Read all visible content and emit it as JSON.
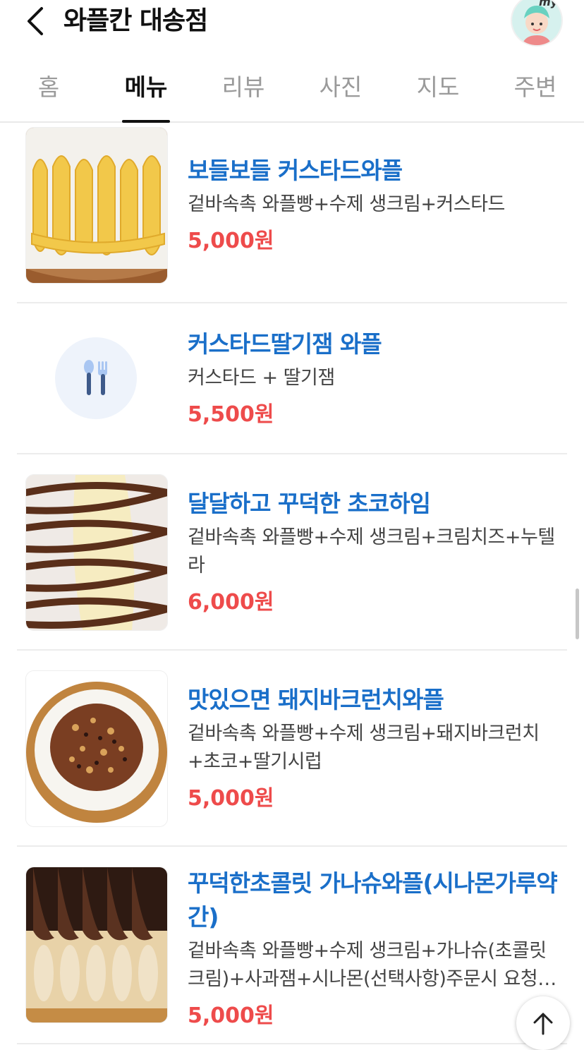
{
  "header": {
    "title": "와플칸 대송점",
    "back_icon": "chevron-left-icon",
    "profile_badge": "my"
  },
  "tabs": [
    {
      "label": "홈",
      "active": false
    },
    {
      "label": "메뉴",
      "active": true
    },
    {
      "label": "리뷰",
      "active": false
    },
    {
      "label": "사진",
      "active": false
    },
    {
      "label": "지도",
      "active": false
    },
    {
      "label": "주변",
      "active": false
    }
  ],
  "menu_items": [
    {
      "name": "보들보들 커스타드와플",
      "description": "겉바속촉 와플빵+수제 생크림+커스타드",
      "price": "5,000원",
      "image": "custard-waffle-photo"
    },
    {
      "name": "커스타드딸기잼 와플",
      "description": "커스타드 + 딸기잼",
      "price": "5,500원",
      "image": "placeholder-utensils-icon"
    },
    {
      "name": "달달하고 꾸덕한 초코하임",
      "description": "겉바속촉 와플빵+수제 생크림+크림치즈+누텔라",
      "price": "6,000원",
      "image": "choco-waffle-photo"
    },
    {
      "name": "맛있으면 돼지바크런치와플",
      "description": "겉바속촉 와플빵+수제 생크림+돼지바크런치+초코+딸기시럽",
      "price": "5,000원",
      "image": "crunch-waffle-photo"
    },
    {
      "name": "꾸덕한초콜릿 가나슈와플(시나몬가루약간)",
      "description": "겉바속촉 와플빵+수제 생크림+가나슈(초콜릿크림)+사과잼+시나몬(선택사항)주문시 요청…",
      "price": "5,000원",
      "image": "ganache-waffle-photo"
    }
  ],
  "scroll_top_icon": "arrow-up-icon",
  "colors": {
    "accent_blue": "#1a6fc9",
    "price_red": "#ee4b4b"
  }
}
